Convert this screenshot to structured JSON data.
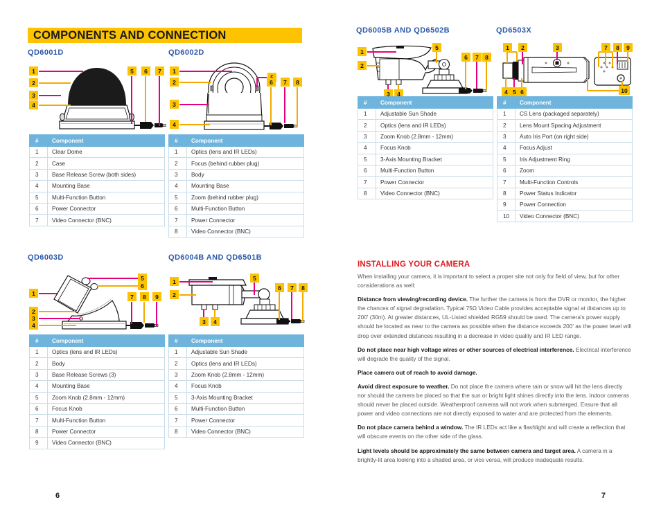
{
  "header": {
    "title": "COMPONENTS AND CONNECTION",
    "bar_color": "#FDC300"
  },
  "colors": {
    "model_heading": "#2C59A8",
    "table_header": "#6FB4DC",
    "section_title": "#E11B22",
    "callout_badge": "#FDC300",
    "leader_pink": "#E6007E",
    "leader_yellow": "#F5A800"
  },
  "table_header": {
    "num": "#",
    "component": "Component"
  },
  "diagrams": {
    "qd6001d": {
      "model": "QD6001D",
      "callouts": [
        "1",
        "2",
        "3",
        "4",
        "5",
        "6",
        "7"
      ]
    },
    "qd6002d": {
      "model": "QD6002D",
      "callouts": [
        "1",
        "2",
        "3",
        "4",
        "5",
        "6",
        "7",
        "8"
      ]
    },
    "qd6003d": {
      "model": "QD6003D",
      "callouts": [
        "1",
        "2",
        "3",
        "4",
        "5",
        "6",
        "7",
        "8",
        "9"
      ]
    },
    "qd6004b": {
      "model": "QD6004B AND QD6501B",
      "callouts": [
        "1",
        "2",
        "3",
        "4",
        "5",
        "6",
        "7",
        "8"
      ]
    },
    "qd6005b": {
      "model": "QD6005B AND QD6502B",
      "callouts": [
        "1",
        "2",
        "3",
        "4",
        "5",
        "6",
        "7",
        "8"
      ]
    },
    "qd6503x": {
      "model": "QD6503X",
      "callouts": [
        "1",
        "2",
        "3",
        "4",
        "5",
        "6",
        "7",
        "8",
        "9",
        "10"
      ]
    }
  },
  "tables": {
    "qd6001d": [
      {
        "n": "1",
        "c": "Clear Dome"
      },
      {
        "n": "2",
        "c": "Case"
      },
      {
        "n": "3",
        "c": "Base Release Screw (both sides)"
      },
      {
        "n": "4",
        "c": "Mounting Base"
      },
      {
        "n": "5",
        "c": "Multi-Function Button"
      },
      {
        "n": "6",
        "c": "Power Connector"
      },
      {
        "n": "7",
        "c": "Video Connector (BNC)"
      }
    ],
    "qd6002d": [
      {
        "n": "1",
        "c": "Optics (lens and IR LEDs)"
      },
      {
        "n": "2",
        "c": "Focus (behind rubber plug)"
      },
      {
        "n": "3",
        "c": "Body"
      },
      {
        "n": "4",
        "c": "Mounting Base"
      },
      {
        "n": "5",
        "c": "Zoom (behind rubber plug)"
      },
      {
        "n": "6",
        "c": "Multi-Function Button"
      },
      {
        "n": "7",
        "c": "Power Connector"
      },
      {
        "n": "8",
        "c": "Video Connector (BNC)"
      }
    ],
    "qd6003d": [
      {
        "n": "1",
        "c": "Optics (lens and IR LEDs)"
      },
      {
        "n": "2",
        "c": "Body"
      },
      {
        "n": "3",
        "c": "Base Release Screws (3)"
      },
      {
        "n": "4",
        "c": "Mounting Base"
      },
      {
        "n": "5",
        "c": "Zoom Knob (2.8mm - 12mm)"
      },
      {
        "n": "6",
        "c": "Focus Knob"
      },
      {
        "n": "7",
        "c": "Multi-Function Button"
      },
      {
        "n": "8",
        "c": "Power Connector"
      },
      {
        "n": "9",
        "c": "Video Connector (BNC)"
      }
    ],
    "qd6004b": [
      {
        "n": "1",
        "c": "Adjustable Sun Shade"
      },
      {
        "n": "2",
        "c": "Optics (lens and IR LEDs)"
      },
      {
        "n": "3",
        "c": "Zoom Knob (2.8mm - 12mm)"
      },
      {
        "n": "4",
        "c": "Focus Knob"
      },
      {
        "n": "5",
        "c": "3-Axis Mounting Bracket"
      },
      {
        "n": "6",
        "c": "Multi-Function Button"
      },
      {
        "n": "7",
        "c": "Power Connector"
      },
      {
        "n": "8",
        "c": "Video Connector (BNC)"
      }
    ],
    "qd6005b": [
      {
        "n": "1",
        "c": "Adjustable Sun Shade"
      },
      {
        "n": "2",
        "c": "Optics (lens and IR LEDs)"
      },
      {
        "n": "3",
        "c": "Zoom Knob (2.8mm - 12mm)"
      },
      {
        "n": "4",
        "c": "Focus Knob"
      },
      {
        "n": "5",
        "c": "3-Axis Mounting Bracket"
      },
      {
        "n": "6",
        "c": "Multi-Function Button"
      },
      {
        "n": "7",
        "c": "Power Connector"
      },
      {
        "n": "8",
        "c": "Video Connector (BNC)"
      }
    ],
    "qd6503x": [
      {
        "n": "1",
        "c": "CS Lens (packaged separately)"
      },
      {
        "n": "2",
        "c": "Lens Mount Spacing Adjustment"
      },
      {
        "n": "3",
        "c": "Auto Iris Port (on right side)"
      },
      {
        "n": "4",
        "c": "Focus Adjust"
      },
      {
        "n": "5",
        "c": "Iris Adjustment Ring"
      },
      {
        "n": "6",
        "c": "Zoom"
      },
      {
        "n": "7",
        "c": "Multi-Function Controls"
      },
      {
        "n": "8",
        "c": "Power Status Indicator"
      },
      {
        "n": "9",
        "c": "Power Connection"
      },
      {
        "n": "10",
        "c": "Video Connector (BNC)"
      }
    ]
  },
  "installing": {
    "title": "INSTALLING YOUR CAMERA",
    "intro": "When installing your camera, it is important to select a proper site not only for field of view, but for other considerations as well:",
    "paragraphs": [
      {
        "lead": "Distance from viewing/recording device.",
        "text": " The further the camera is from the DVR or monitor, the higher the chances of signal degradation. Typical 75Ω Video Cable provides acceptable signal at distances up to 200' (30m). At greater distances, UL-Listed shielded RG59 should be used. The camera's power supply should be located as near to the camera as possible when the distance exceeds 200' as the power level will drop over extended distances resulting in a decrease in video quality and IR LED range."
      },
      {
        "lead": "Do not place near high voltage wires or other sources of electrical interference.",
        "text": " Electrical interference will degrade the quality of the signal."
      },
      {
        "lead": "Place camera out of reach to avoid damage.",
        "text": ""
      },
      {
        "lead": "Avoid direct exposure to weather.",
        "text": " Do not place the camera where rain or snow will hit the lens directly nor should the camera be placed so that the sun or bright light shines directly into the lens. Indoor cameras should never be placed outside. Weatherproof cameras will not work when submerged. Ensure that all power and video connections are not directly exposed to water and are protected from the elements."
      },
      {
        "lead": "Do not place camera behind a window.",
        "text": " The IR LEDs act like a flashlight and will create a reflection that will obscure events on the other side of the glass."
      },
      {
        "lead": "Light levels should be approximately the same between camera and target area.",
        "text": " A camera in a brightly-lit area looking into a shaded area, or vice versa, will produce inadequate results."
      }
    ]
  },
  "page_numbers": {
    "left": "6",
    "right": "7"
  }
}
